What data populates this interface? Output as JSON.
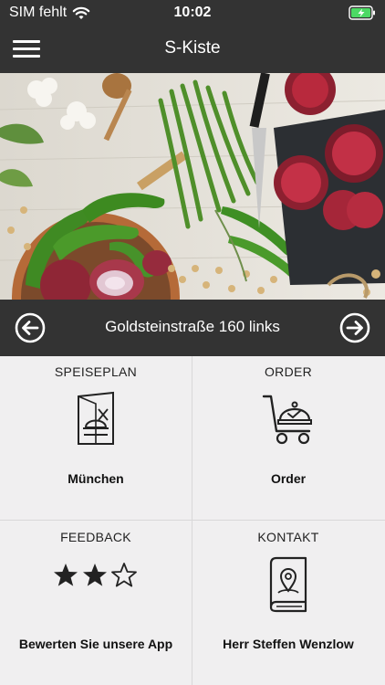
{
  "status": {
    "carrier": "SIM fehlt",
    "time": "10:02",
    "battery_icon": "battery-charging-icon",
    "wifi_icon": "wifi-icon"
  },
  "nav": {
    "title": "S-Kiste",
    "menu_icon": "hamburger-menu-icon"
  },
  "hero": {
    "description_icon": "vegetables-photo"
  },
  "location": {
    "name": "Goldsteinstraße 160 links",
    "prev_icon": "arrow-left-circle-icon",
    "next_icon": "arrow-right-circle-icon"
  },
  "tiles": [
    {
      "heading": "SPEISEPLAN",
      "label": "München",
      "icon": "menu-card-icon"
    },
    {
      "heading": "ORDER",
      "label": "Order",
      "icon": "food-cart-icon"
    },
    {
      "heading": "FEEDBACK",
      "label": "Bewerten Sie unsere App",
      "icon": "rating-stars-icon",
      "rating": 2,
      "rating_max": 3
    },
    {
      "heading": "KONTAKT",
      "label": "Herr Steffen Wenzlow",
      "icon": "contact-book-icon"
    }
  ],
  "colors": {
    "bar": "#333333",
    "background": "#f0eff0",
    "battery": "#4cd964"
  }
}
